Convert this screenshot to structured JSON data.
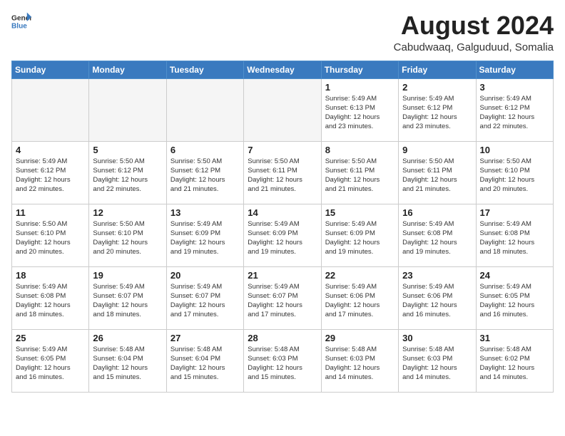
{
  "header": {
    "logo_general": "General",
    "logo_blue": "Blue",
    "title": "August 2024",
    "subtitle": "Cabudwaaq, Galguduud, Somalia"
  },
  "weekdays": [
    "Sunday",
    "Monday",
    "Tuesday",
    "Wednesday",
    "Thursday",
    "Friday",
    "Saturday"
  ],
  "weeks": [
    [
      {
        "day": "",
        "info": "",
        "empty": true
      },
      {
        "day": "",
        "info": "",
        "empty": true
      },
      {
        "day": "",
        "info": "",
        "empty": true
      },
      {
        "day": "",
        "info": "",
        "empty": true
      },
      {
        "day": "1",
        "info": "Sunrise: 5:49 AM\nSunset: 6:13 PM\nDaylight: 12 hours\nand 23 minutes."
      },
      {
        "day": "2",
        "info": "Sunrise: 5:49 AM\nSunset: 6:12 PM\nDaylight: 12 hours\nand 23 minutes."
      },
      {
        "day": "3",
        "info": "Sunrise: 5:49 AM\nSunset: 6:12 PM\nDaylight: 12 hours\nand 22 minutes."
      }
    ],
    [
      {
        "day": "4",
        "info": "Sunrise: 5:49 AM\nSunset: 6:12 PM\nDaylight: 12 hours\nand 22 minutes."
      },
      {
        "day": "5",
        "info": "Sunrise: 5:50 AM\nSunset: 6:12 PM\nDaylight: 12 hours\nand 22 minutes."
      },
      {
        "day": "6",
        "info": "Sunrise: 5:50 AM\nSunset: 6:12 PM\nDaylight: 12 hours\nand 21 minutes."
      },
      {
        "day": "7",
        "info": "Sunrise: 5:50 AM\nSunset: 6:11 PM\nDaylight: 12 hours\nand 21 minutes."
      },
      {
        "day": "8",
        "info": "Sunrise: 5:50 AM\nSunset: 6:11 PM\nDaylight: 12 hours\nand 21 minutes."
      },
      {
        "day": "9",
        "info": "Sunrise: 5:50 AM\nSunset: 6:11 PM\nDaylight: 12 hours\nand 21 minutes."
      },
      {
        "day": "10",
        "info": "Sunrise: 5:50 AM\nSunset: 6:10 PM\nDaylight: 12 hours\nand 20 minutes."
      }
    ],
    [
      {
        "day": "11",
        "info": "Sunrise: 5:50 AM\nSunset: 6:10 PM\nDaylight: 12 hours\nand 20 minutes."
      },
      {
        "day": "12",
        "info": "Sunrise: 5:50 AM\nSunset: 6:10 PM\nDaylight: 12 hours\nand 20 minutes."
      },
      {
        "day": "13",
        "info": "Sunrise: 5:49 AM\nSunset: 6:09 PM\nDaylight: 12 hours\nand 19 minutes."
      },
      {
        "day": "14",
        "info": "Sunrise: 5:49 AM\nSunset: 6:09 PM\nDaylight: 12 hours\nand 19 minutes."
      },
      {
        "day": "15",
        "info": "Sunrise: 5:49 AM\nSunset: 6:09 PM\nDaylight: 12 hours\nand 19 minutes."
      },
      {
        "day": "16",
        "info": "Sunrise: 5:49 AM\nSunset: 6:08 PM\nDaylight: 12 hours\nand 19 minutes."
      },
      {
        "day": "17",
        "info": "Sunrise: 5:49 AM\nSunset: 6:08 PM\nDaylight: 12 hours\nand 18 minutes."
      }
    ],
    [
      {
        "day": "18",
        "info": "Sunrise: 5:49 AM\nSunset: 6:08 PM\nDaylight: 12 hours\nand 18 minutes."
      },
      {
        "day": "19",
        "info": "Sunrise: 5:49 AM\nSunset: 6:07 PM\nDaylight: 12 hours\nand 18 minutes."
      },
      {
        "day": "20",
        "info": "Sunrise: 5:49 AM\nSunset: 6:07 PM\nDaylight: 12 hours\nand 17 minutes."
      },
      {
        "day": "21",
        "info": "Sunrise: 5:49 AM\nSunset: 6:07 PM\nDaylight: 12 hours\nand 17 minutes."
      },
      {
        "day": "22",
        "info": "Sunrise: 5:49 AM\nSunset: 6:06 PM\nDaylight: 12 hours\nand 17 minutes."
      },
      {
        "day": "23",
        "info": "Sunrise: 5:49 AM\nSunset: 6:06 PM\nDaylight: 12 hours\nand 16 minutes."
      },
      {
        "day": "24",
        "info": "Sunrise: 5:49 AM\nSunset: 6:05 PM\nDaylight: 12 hours\nand 16 minutes."
      }
    ],
    [
      {
        "day": "25",
        "info": "Sunrise: 5:49 AM\nSunset: 6:05 PM\nDaylight: 12 hours\nand 16 minutes."
      },
      {
        "day": "26",
        "info": "Sunrise: 5:48 AM\nSunset: 6:04 PM\nDaylight: 12 hours\nand 15 minutes."
      },
      {
        "day": "27",
        "info": "Sunrise: 5:48 AM\nSunset: 6:04 PM\nDaylight: 12 hours\nand 15 minutes."
      },
      {
        "day": "28",
        "info": "Sunrise: 5:48 AM\nSunset: 6:03 PM\nDaylight: 12 hours\nand 15 minutes."
      },
      {
        "day": "29",
        "info": "Sunrise: 5:48 AM\nSunset: 6:03 PM\nDaylight: 12 hours\nand 14 minutes."
      },
      {
        "day": "30",
        "info": "Sunrise: 5:48 AM\nSunset: 6:03 PM\nDaylight: 12 hours\nand 14 minutes."
      },
      {
        "day": "31",
        "info": "Sunrise: 5:48 AM\nSunset: 6:02 PM\nDaylight: 12 hours\nand 14 minutes."
      }
    ]
  ]
}
